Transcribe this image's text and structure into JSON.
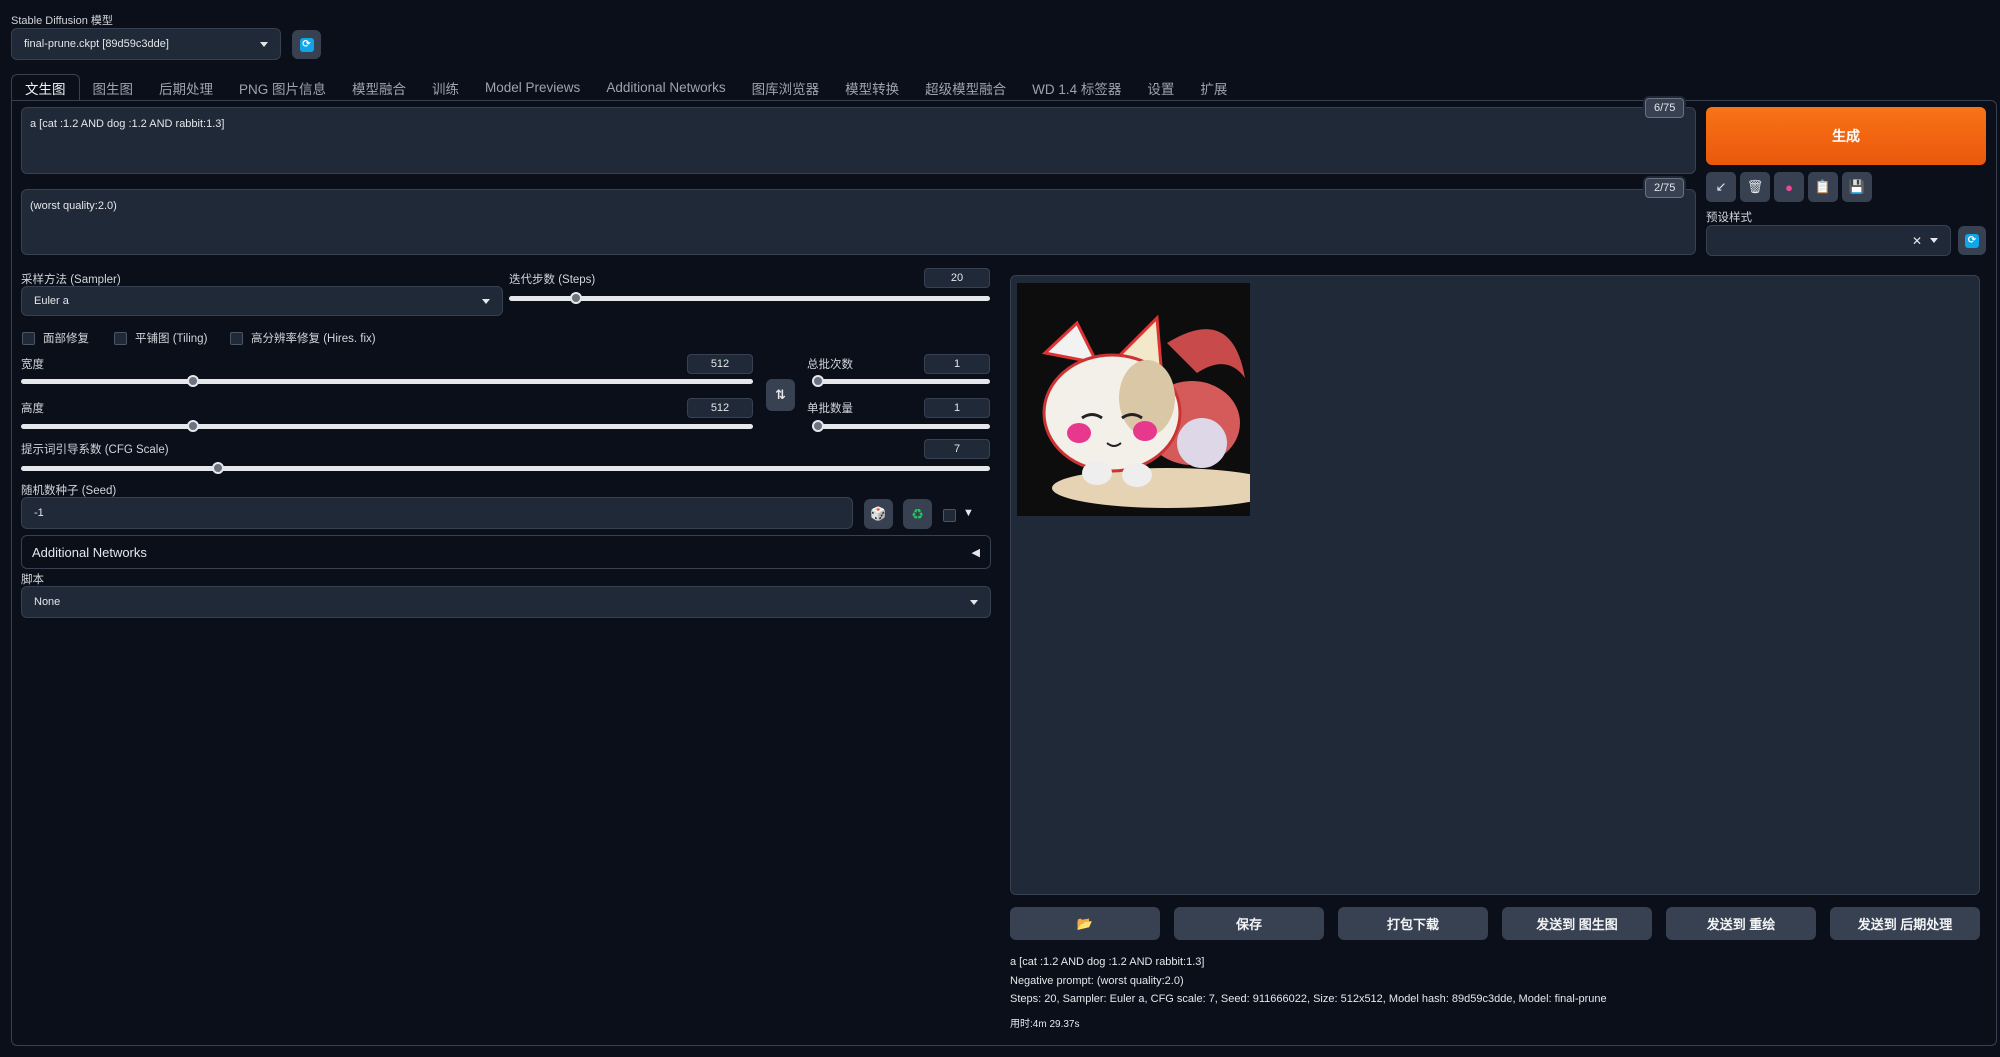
{
  "model": {
    "label": "Stable Diffusion 模型",
    "value": "final-prune.ckpt [89d59c3dde]"
  },
  "tabs": [
    {
      "label": "文生图",
      "active": true
    },
    {
      "label": "图生图"
    },
    {
      "label": "后期处理"
    },
    {
      "label": "PNG 图片信息"
    },
    {
      "label": "模型融合"
    },
    {
      "label": "训练"
    },
    {
      "label": "Model Previews"
    },
    {
      "label": "Additional Networks"
    },
    {
      "label": "图库浏览器"
    },
    {
      "label": "模型转换"
    },
    {
      "label": "超级模型融合"
    },
    {
      "label": "WD 1.4 标签器"
    },
    {
      "label": "设置"
    },
    {
      "label": "扩展"
    }
  ],
  "prompt": {
    "positive": "a [cat :1.2 AND dog :1.2 AND rabbit:1.3]",
    "positive_counter": "6/75",
    "negative": "(worst quality:2.0)",
    "negative_counter": "2/75"
  },
  "generate_label": "生成",
  "tools": [
    "↙",
    "🗑",
    "●",
    "📋",
    "💾"
  ],
  "styles": {
    "label": "预设样式",
    "value": ""
  },
  "sampler": {
    "label": "采样方法 (Sampler)",
    "value": "Euler a"
  },
  "steps": {
    "label": "迭代步数 (Steps)",
    "value": "20",
    "fraction": 0.13
  },
  "checkboxes": {
    "face": "面部修复",
    "tiling": "平铺图 (Tiling)",
    "hires": "高分辨率修复 (Hires. fix)"
  },
  "width": {
    "label": "宽度",
    "value": "512",
    "fraction": 0.23
  },
  "height": {
    "label": "高度",
    "value": "512",
    "fraction": 0.23
  },
  "batch_count": {
    "label": "总批次数",
    "value": "1",
    "fraction": 0
  },
  "batch_size": {
    "label": "单批数量",
    "value": "1",
    "fraction": 0
  },
  "cfg": {
    "label": "提示词引导系数 (CFG Scale)",
    "value": "7",
    "fraction": 0.2
  },
  "seed": {
    "label": "随机数种子 (Seed)",
    "value": "-1"
  },
  "additional_networks": "Additional Networks",
  "script": {
    "label": "脚本",
    "value": "None"
  },
  "actions": {
    "folder": "📂",
    "save": "保存",
    "zip": "打包下载",
    "to_img2img": "发送到 图生图",
    "to_inpaint": "发送到 重绘",
    "to_extras": "发送到 后期处理"
  },
  "info": {
    "line1": "a [cat :1.2 AND dog :1.2 AND rabbit:1.3]",
    "line2": "Negative prompt: (worst quality:2.0)",
    "line3": "Steps: 20, Sampler: Euler a, CFG scale: 7, Seed: 911666022, Size: 512x512, Model hash: 89d59c3dde, Model: final-prune",
    "time": "用时:4m 29.37s"
  },
  "colors": {
    "accent": "#ea580c",
    "refresh": "#0ea5e9"
  }
}
